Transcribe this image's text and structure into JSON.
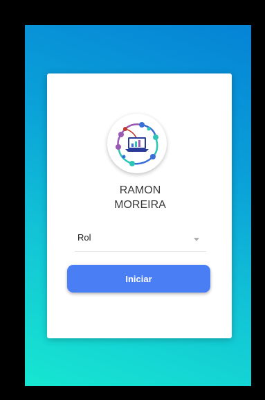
{
  "profile": {
    "name_line1": "RAMON",
    "name_line2": "MOREIRA",
    "logo_icon": "laptop-network-icon"
  },
  "form": {
    "role_select_value": "Rol",
    "submit_label": "Iniciar"
  },
  "colors": {
    "gradient_start": "#17e6d1",
    "gradient_end": "#0683d6",
    "button": "#4a7ef5"
  }
}
